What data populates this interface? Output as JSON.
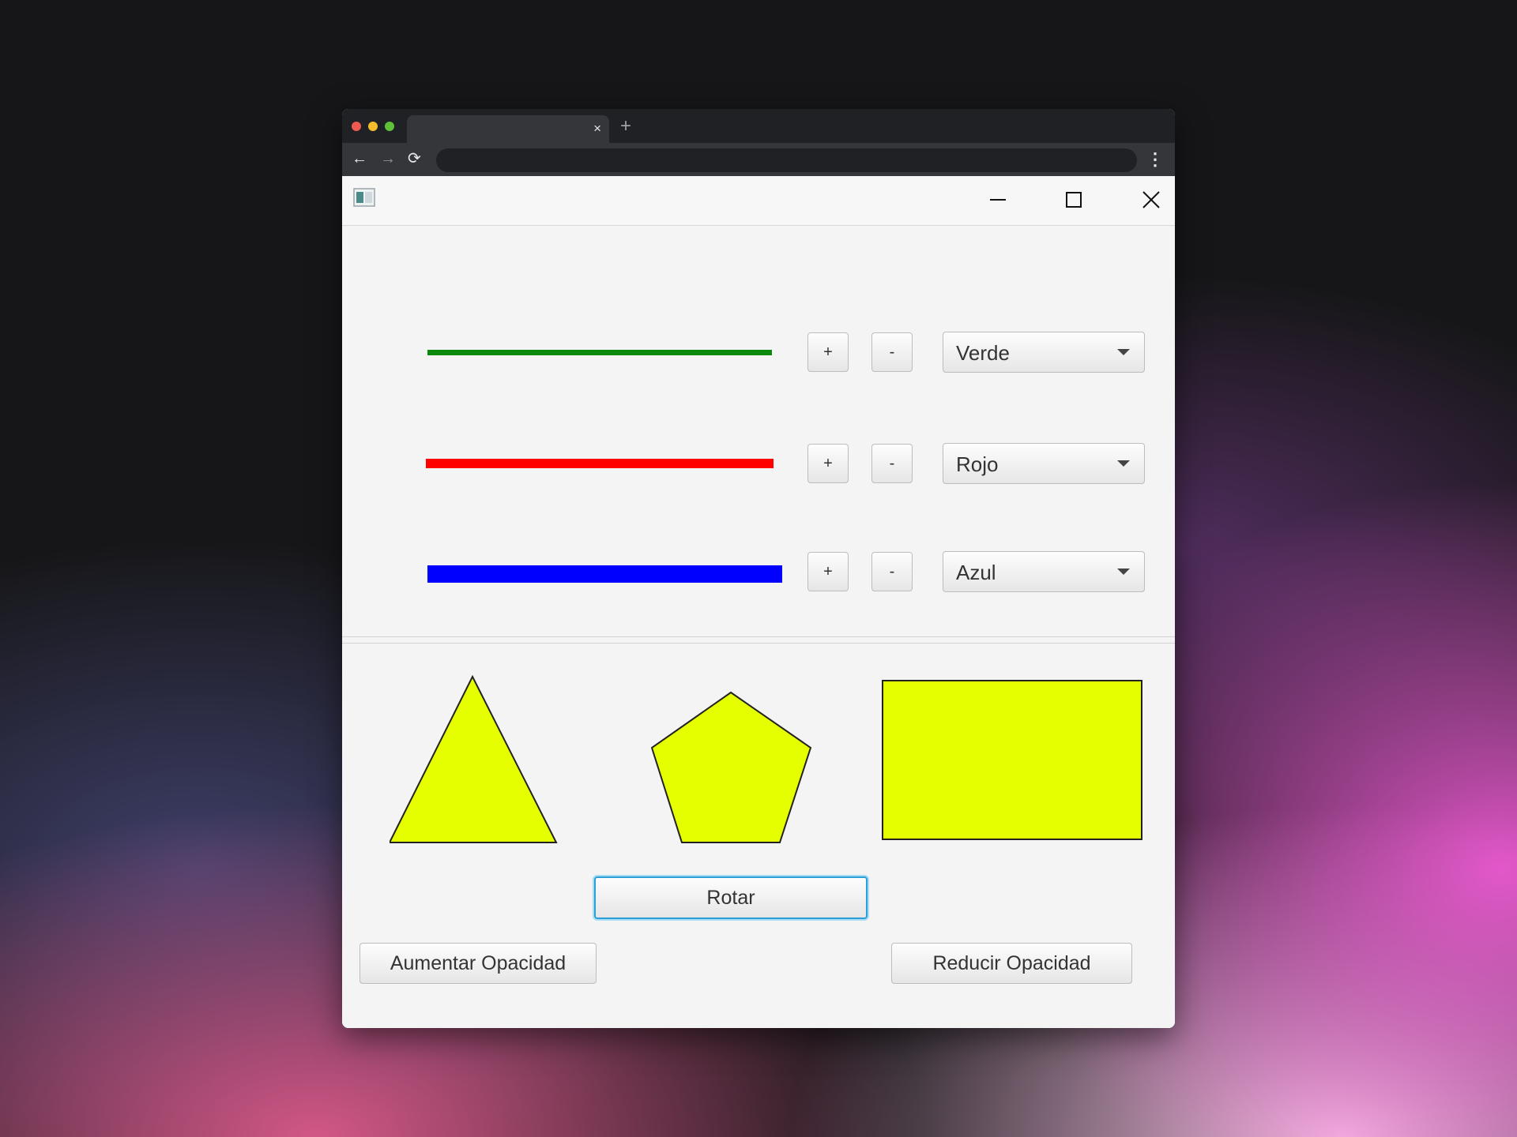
{
  "browser": {
    "tab_close": "×",
    "new_tab": "+",
    "back": "←",
    "forward": "→",
    "reload": "⟳",
    "menu": "⋮"
  },
  "colors": {
    "line_green": "#0a8a0a",
    "line_red": "#ff0000",
    "line_blue": "#0000ff",
    "shape_fill": "#e6ff00",
    "focus_border": "#2d9fd8"
  },
  "lines": [
    {
      "plus_label": "+",
      "minus_label": "-",
      "color_selected": "Verde"
    },
    {
      "plus_label": "+",
      "minus_label": "-",
      "color_selected": "Rojo"
    },
    {
      "plus_label": "+",
      "minus_label": "-",
      "color_selected": "Azul"
    }
  ],
  "buttons": {
    "rotate_label": "Rotar",
    "increase_opacity_label": "Aumentar Opacidad",
    "decrease_opacity_label": "Reducir Opacidad"
  }
}
